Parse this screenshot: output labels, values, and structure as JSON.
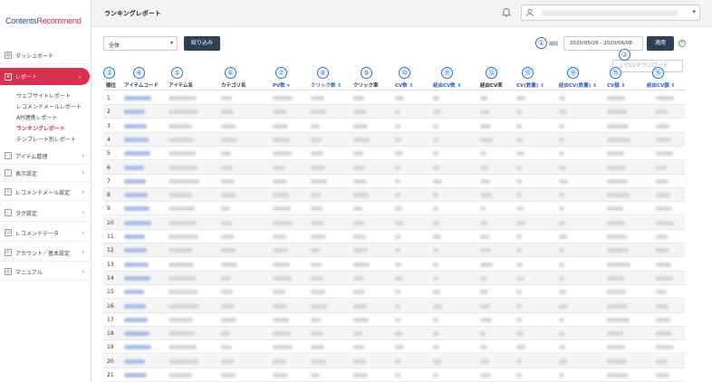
{
  "app": {
    "logo_main": "Contents",
    "logo_accent": "Recommend"
  },
  "header": {
    "title": "ランキングレポート"
  },
  "sidebar": {
    "items": [
      {
        "label": "ダッシュボード",
        "icon": "dashboard-icon",
        "chevron": ""
      },
      {
        "label": "レポート",
        "icon": "report-icon",
        "chevron": "⌄"
      },
      {
        "label": "アイテム管理",
        "icon": "item-icon",
        "chevron": "›"
      },
      {
        "label": "表示設定",
        "icon": "star-icon",
        "chevron": "›"
      },
      {
        "label": "レコメンドメール設定",
        "icon": "mail-icon",
        "chevron": "›"
      },
      {
        "label": "タグ設定",
        "icon": "code-icon",
        "chevron": "›"
      },
      {
        "label": "レコメンドデータ",
        "icon": "data-icon",
        "chevron": "›"
      },
      {
        "label": "アカウント／基本設定",
        "icon": "gear-icon",
        "chevron": "›"
      },
      {
        "label": "マニュアル",
        "icon": "book-icon",
        "chevron": "›"
      }
    ],
    "report_sub": [
      {
        "label": "ウェブサイトレポート"
      },
      {
        "label": "レコメンドメールレポート"
      },
      {
        "label": "API連携レポート"
      },
      {
        "label": "ランキングレポート"
      },
      {
        "label": "テンプレート別レポート"
      }
    ]
  },
  "controls": {
    "filter_value": "全体",
    "filter_button": "絞り込み",
    "period_label": "期間",
    "period_value": "2020/05/26 - 2020/06/08",
    "apply_button": "適用",
    "help": "?",
    "csv_button": "CSVダウンロード"
  },
  "table": {
    "headers": [
      {
        "label": "順位"
      },
      {
        "label": "アイテムコード"
      },
      {
        "label": "アイテム名"
      },
      {
        "label": "カテゴリ名"
      },
      {
        "label": "PV数 ▾"
      },
      {
        "label": "クリック数 ⇕"
      },
      {
        "label": "クリック率"
      },
      {
        "label": "CV数 ⇕"
      },
      {
        "label": "経由CV数 ⇕"
      },
      {
        "label": "経由CV率"
      },
      {
        "label": "CV(数量) ⇕"
      },
      {
        "label": "経由CV(数量) ⇕"
      },
      {
        "label": "CV額 ⇕"
      },
      {
        "label": "経由CV額 ⇕"
      }
    ],
    "ranks": [
      "1",
      "2",
      "3",
      "4",
      "5",
      "6",
      "7",
      "8",
      "9",
      "10",
      "11",
      "12",
      "13",
      "14",
      "15",
      "16",
      "17",
      "18",
      "19",
      "20",
      "21"
    ]
  },
  "callouts": [
    "①",
    "②",
    "③",
    "④",
    "⑤",
    "⑥",
    "⑦",
    "⑧",
    "⑨",
    "⑩",
    "⑪",
    "⑫",
    "⑬",
    "⑭",
    "⑮",
    "⑯"
  ],
  "colors": {
    "accent": "#d8304f",
    "button": "#2f3f55",
    "callout": "#1e6fd9",
    "link": "#3a63c4"
  }
}
